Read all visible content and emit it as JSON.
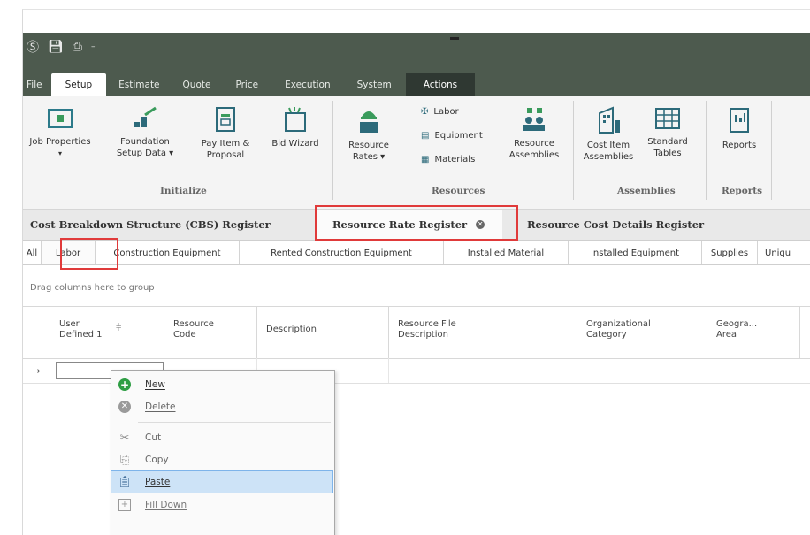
{
  "qat": {
    "icons": [
      "app-logo-icon",
      "save-icon",
      "print-icon",
      "dropdown-icon"
    ]
  },
  "ribbon_tabs": [
    "File",
    "Setup",
    "Estimate",
    "Quote",
    "Price",
    "Execution",
    "System",
    "Actions"
  ],
  "ribbon": {
    "job_properties": "Job Properties",
    "foundation_setup": "Foundation\nSetup Data ▾",
    "pay_item": "Pay Item &\nProposal",
    "bid_wizard": "Bid Wizard",
    "resource_rates": "Resource\nRates ▾",
    "labor": "Labor",
    "equipment": "Equipment",
    "materials": "Materials",
    "resource_assemblies": "Resource\nAssemblies",
    "cost_item_assemblies": "Cost Item\nAssemblies",
    "standard_tables": "Standard\nTables",
    "reports": "Reports",
    "groups": {
      "initialize": "Initialize",
      "resources": "Resources",
      "assemblies": "Assemblies",
      "reports": "Reports"
    }
  },
  "doc_tabs": [
    "Cost Breakdown Structure (CBS) Register",
    "Resource Rate Register",
    "Resource Cost Details Register"
  ],
  "filter_tabs": [
    "All",
    "Labor",
    "Construction Equipment",
    "Rented Construction Equipment",
    "Installed Material",
    "Installed Equipment",
    "Supplies",
    "Uniqu"
  ],
  "drag_hint": "Drag columns here to group",
  "columns": [
    "User\nDefined 1",
    "Resource\nCode",
    "Description",
    "Resource File\nDescription",
    "Organizational\nCategory",
    "Geogra...\nArea"
  ],
  "row_indicator": "→",
  "context_menu": {
    "new": "New",
    "delete": "Delete",
    "cut": "Cut",
    "copy": "Copy",
    "paste": "Paste",
    "fill_down": "Fill Down"
  },
  "colors": {
    "accent_red": "#e03a3a",
    "ribbon_dark": "#4d5a4e",
    "highlight": "#cde3f7"
  }
}
